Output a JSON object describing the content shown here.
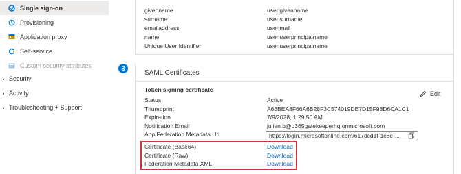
{
  "sidebar": {
    "items": [
      {
        "label": "Single sign-on",
        "icon": "sso-icon"
      },
      {
        "label": "Provisioning",
        "icon": "provisioning-icon"
      },
      {
        "label": "Application proxy",
        "icon": "app-proxy-icon"
      },
      {
        "label": "Self-service",
        "icon": "self-service-icon"
      },
      {
        "label": "Custom security attributes",
        "icon": "custom-attributes-icon"
      }
    ],
    "groups": [
      {
        "label": "Security"
      },
      {
        "label": "Activity"
      },
      {
        "label": "Troubleshooting + Support"
      }
    ]
  },
  "attributes": [
    {
      "name": "givenname",
      "value": "user.givenname"
    },
    {
      "name": "surname",
      "value": "user.surname"
    },
    {
      "name": "emailaddress",
      "value": "user.mail"
    },
    {
      "name": "name",
      "value": "user.userprincipalname"
    },
    {
      "name": "Unique User Identifier",
      "value": "user.userprincipalname"
    }
  ],
  "saml": {
    "step": "3",
    "title": "SAML Certificates",
    "cert_title": "Token signing certificate",
    "edit_label": "Edit",
    "rows": [
      {
        "k": "Status",
        "v": "Active"
      },
      {
        "k": "Thumbprint",
        "v": "A66BEA8F66A6B28F3C574019DE7D15F98D6CA1C1"
      },
      {
        "k": "Expiration",
        "v": "7/9/2028, 1:29:50 AM"
      },
      {
        "k": "Notification Email",
        "v": "julien.b@o365gatekeeperhq.onmicrosoft.com"
      },
      {
        "k": "App Federation Metadata Url",
        "v": ""
      }
    ],
    "metadata_url": "https://login.microsoftonline.com/617dcd1f-1c8e-...",
    "downloads": [
      {
        "k": "Certificate (Base64)",
        "v": "Download"
      },
      {
        "k": "Certificate (Raw)",
        "v": "Download"
      },
      {
        "k": "Federation Metadata XML",
        "v": "Download"
      }
    ]
  }
}
